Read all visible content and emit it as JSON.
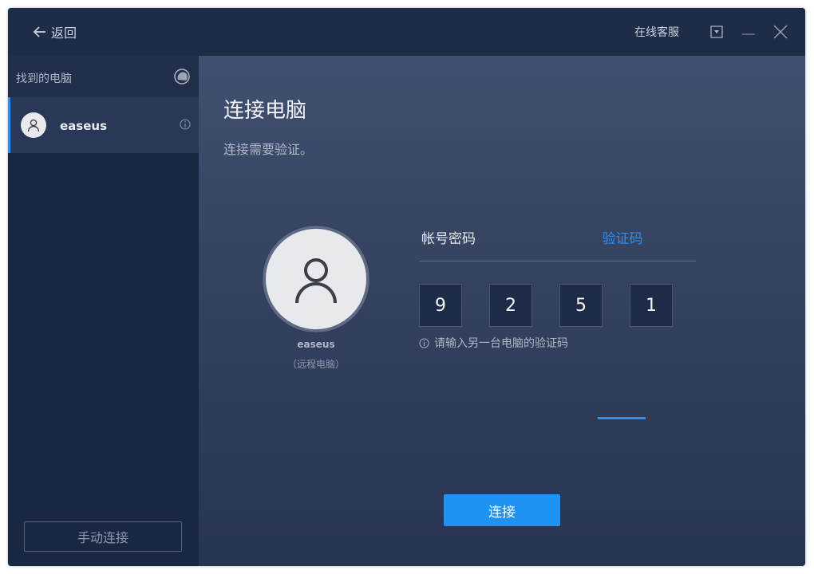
{
  "titlebar": {
    "back_label": "返回",
    "service_label": "在线客服"
  },
  "sidebar": {
    "title": "找到的电脑",
    "computers": [
      {
        "name": "easeus"
      }
    ],
    "manual_connect_label": "手动连接"
  },
  "main": {
    "title": "连接电脑",
    "subtitle": "连接需要验证。",
    "remote": {
      "name": "easeus",
      "tag": "（远程电脑）"
    },
    "tabs": [
      {
        "label": "帐号密码",
        "active": false
      },
      {
        "label": "验证码",
        "active": true
      }
    ],
    "code_digits": [
      "9",
      "2",
      "5",
      "1"
    ],
    "hint": "请输入另一台电脑的验证码",
    "connect_label": "连接"
  },
  "colors": {
    "accent": "#1f93f3",
    "sidebar_bg": "#1a2742",
    "titlebar_bg": "#1f2c47"
  }
}
